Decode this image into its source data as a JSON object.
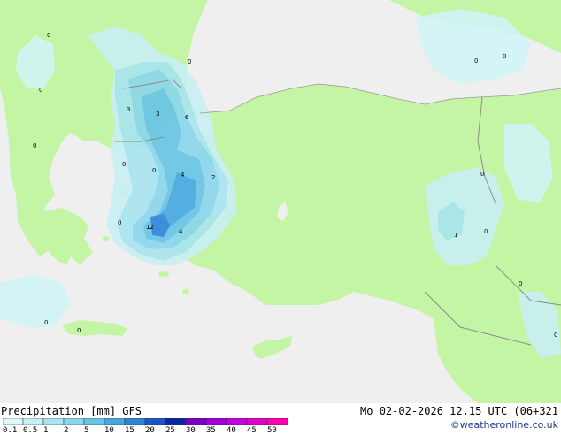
{
  "footer": {
    "title": "Precipitation [mm]  GFS",
    "datetime": "Mo 02-02-2026 12.15 UTC (06+321",
    "credit": "©weatheronline.co.uk"
  },
  "legend": {
    "labels": [
      "0.1",
      "0.5",
      "1",
      "2",
      "5",
      "10",
      "15",
      "20",
      "25",
      "30",
      "35",
      "40",
      "45",
      "50"
    ],
    "colors": [
      "#e0f8f8",
      "#c8f0f4",
      "#a8e4f0",
      "#8ad6ec",
      "#66c4e6",
      "#44a8e0",
      "#2c84d8",
      "#1c54c4",
      "#0c28a0",
      "#7a00c8",
      "#a000d8",
      "#c400e0",
      "#e000c8",
      "#ff00b0"
    ]
  },
  "map_labels": [
    {
      "text": "0"
    },
    {
      "text": "0"
    },
    {
      "text": "0"
    },
    {
      "text": "0"
    },
    {
      "text": "3"
    },
    {
      "text": "3"
    },
    {
      "text": "6"
    },
    {
      "text": "0"
    },
    {
      "text": "0"
    },
    {
      "text": "4"
    },
    {
      "text": "2"
    },
    {
      "text": "0"
    },
    {
      "text": "12"
    },
    {
      "text": "4"
    },
    {
      "text": "0"
    },
    {
      "text": "0"
    },
    {
      "text": "0"
    },
    {
      "text": "0"
    },
    {
      "text": "0"
    },
    {
      "text": "1"
    },
    {
      "text": "0"
    },
    {
      "text": "0"
    },
    {
      "text": "0"
    }
  ],
  "colors": {
    "sea": "#efefef",
    "land": "#c4f5a4",
    "border": "#8c8c8c",
    "coast": "#9a9a9a"
  }
}
